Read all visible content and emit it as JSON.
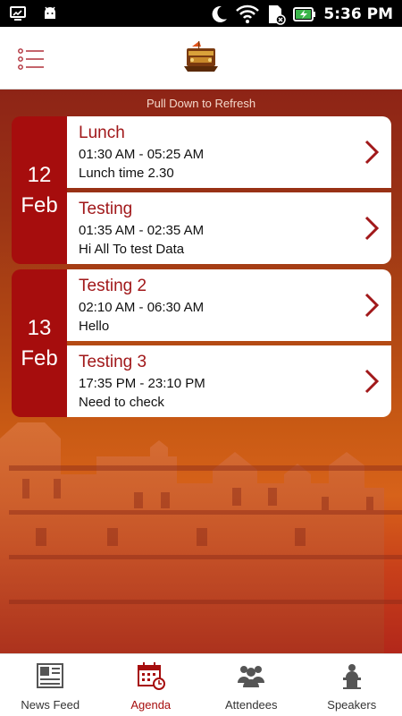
{
  "status_bar": {
    "time": "5:36 PM",
    "icons": [
      "screen-cast-icon",
      "android-icon",
      "moon-icon",
      "wifi-icon",
      "sd-card-icon",
      "battery-charging-icon"
    ]
  },
  "app_bar": {
    "menu_icon": "list-menu-icon",
    "logo": "event-logo"
  },
  "pull_to_refresh": "Pull Down to Refresh",
  "agenda": {
    "days": [
      {
        "day": "12",
        "month": "Feb",
        "sessions": [
          {
            "title": "Lunch",
            "time": "01:30 AM - 05:25 AM",
            "description": "Lunch time 2.30"
          },
          {
            "title": "Testing",
            "time": "01:35 AM - 02:35 AM",
            "description": "Hi All To test Data"
          }
        ]
      },
      {
        "day": "13",
        "month": "Feb",
        "sessions": [
          {
            "title": "Testing 2",
            "time": "02:10 AM - 06:30 AM",
            "description": "Hello"
          },
          {
            "title": "Testing 3",
            "time": "17:35 PM - 23:10 PM",
            "description": "Need to check"
          }
        ]
      }
    ]
  },
  "bottom_nav": {
    "items": [
      {
        "label": "News Feed",
        "icon": "newspaper-icon",
        "active": false
      },
      {
        "label": "Agenda",
        "icon": "calendar-icon",
        "active": true
      },
      {
        "label": "Attendees",
        "icon": "people-icon",
        "active": false
      },
      {
        "label": "Speakers",
        "icon": "podium-speaker-icon",
        "active": false
      }
    ]
  },
  "colors": {
    "accent": "#a60d0d",
    "title_text": "#a1181a"
  }
}
